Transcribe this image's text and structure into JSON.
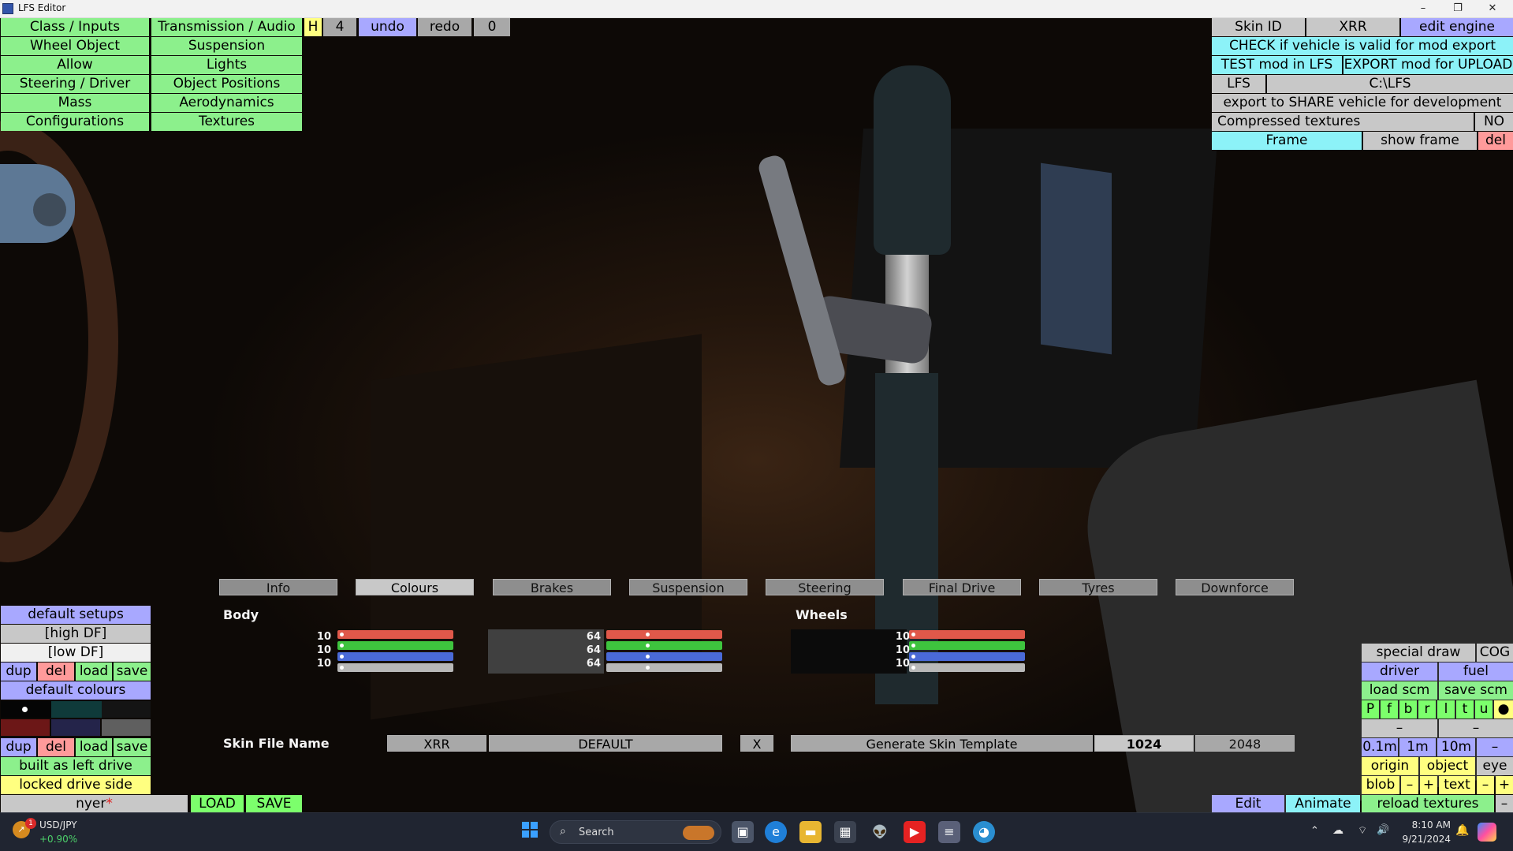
{
  "window": {
    "title": "LFS Editor",
    "min": "–",
    "max": "❐",
    "close": "✕"
  },
  "left_menu": {
    "col1": [
      "Class / Inputs",
      "Wheel Object",
      "Allow",
      "Steering / Driver",
      "Mass",
      "Configurations"
    ],
    "col2": [
      "Transmission / Audio",
      "Suspension",
      "Lights",
      "Object Positions",
      "Aerodynamics",
      "Textures"
    ]
  },
  "toolbar": {
    "h": "H",
    "count": "4",
    "undo": "undo",
    "redo": "redo",
    "zero": "0"
  },
  "right_panel": {
    "skin_id": "Skin ID",
    "xrr": "XRR",
    "edit_engine": "edit engine",
    "check": "CHECK if vehicle is valid for mod export",
    "test": "TEST mod in LFS",
    "export": "EXPORT mod for UPLOAD",
    "lfs": "LFS",
    "path": "C:\\LFS",
    "share": "export to SHARE vehicle for development",
    "compressed": "Compressed textures",
    "compressed_val": "NO",
    "frame": "Frame",
    "show_frame": "show frame",
    "del": "del"
  },
  "tabs": [
    "Info",
    "Colours",
    "Brakes",
    "Suspension",
    "Steering",
    "Final Drive",
    "Tyres",
    "Downforce"
  ],
  "active_tab": "Colours",
  "colours": {
    "body_label": "Body",
    "wheels_label": "Wheels",
    "body": {
      "r": "10",
      "g": "10",
      "b": "10"
    },
    "body2": {
      "r": "64",
      "g": "64",
      "b": "64"
    },
    "wheels": {
      "r": "10",
      "g": "10",
      "b": "10"
    }
  },
  "skin": {
    "label": "Skin File Name",
    "car": "XRR",
    "file": "DEFAULT",
    "x": "X",
    "generate": "Generate Skin Template",
    "size1": "1024",
    "size2": "2048"
  },
  "left_bottom": {
    "default_setups": "default setups",
    "high_df": "[high DF]",
    "low_df": "[low DF]",
    "dup": "dup",
    "del": "del",
    "load": "load",
    "save": "save",
    "default_colours": "default colours",
    "built_left": "built as left drive",
    "locked_side": "locked drive side",
    "user": "nyer",
    "user_mark": "*",
    "load_caps": "LOAD",
    "save_caps": "SAVE"
  },
  "right_bottom": {
    "special_draw": "special draw",
    "cog": "COG",
    "driver": "driver",
    "fuel": "fuel",
    "load_scm": "load scm",
    "save_scm": "save scm",
    "letters": [
      "P",
      "f",
      "b",
      "r",
      "l",
      "t",
      "u",
      "●"
    ],
    "dash": "–",
    "step1": "0.1m",
    "step2": "1m",
    "step3": "10m",
    "origin": "origin",
    "object": "object",
    "eye": "eye",
    "blob": "blob",
    "minus": "–",
    "plus": "+",
    "text": "text"
  },
  "bottom_bar": {
    "edit": "Edit",
    "animate": "Animate",
    "reload": "reload textures",
    "minus": "–"
  },
  "taskbar": {
    "ticker": "USD/JPY",
    "change": "+0.90%",
    "badge": "1",
    "search": "Search",
    "time": "8:10 AM",
    "date": "9/21/2024"
  },
  "colors": {
    "green": "#8cf08c",
    "cyan": "#8cf2f8",
    "purple": "#a8a8ff",
    "grey": "#c8c8c8",
    "pink": "#ff9a9a",
    "yellow": "#ffff80"
  }
}
